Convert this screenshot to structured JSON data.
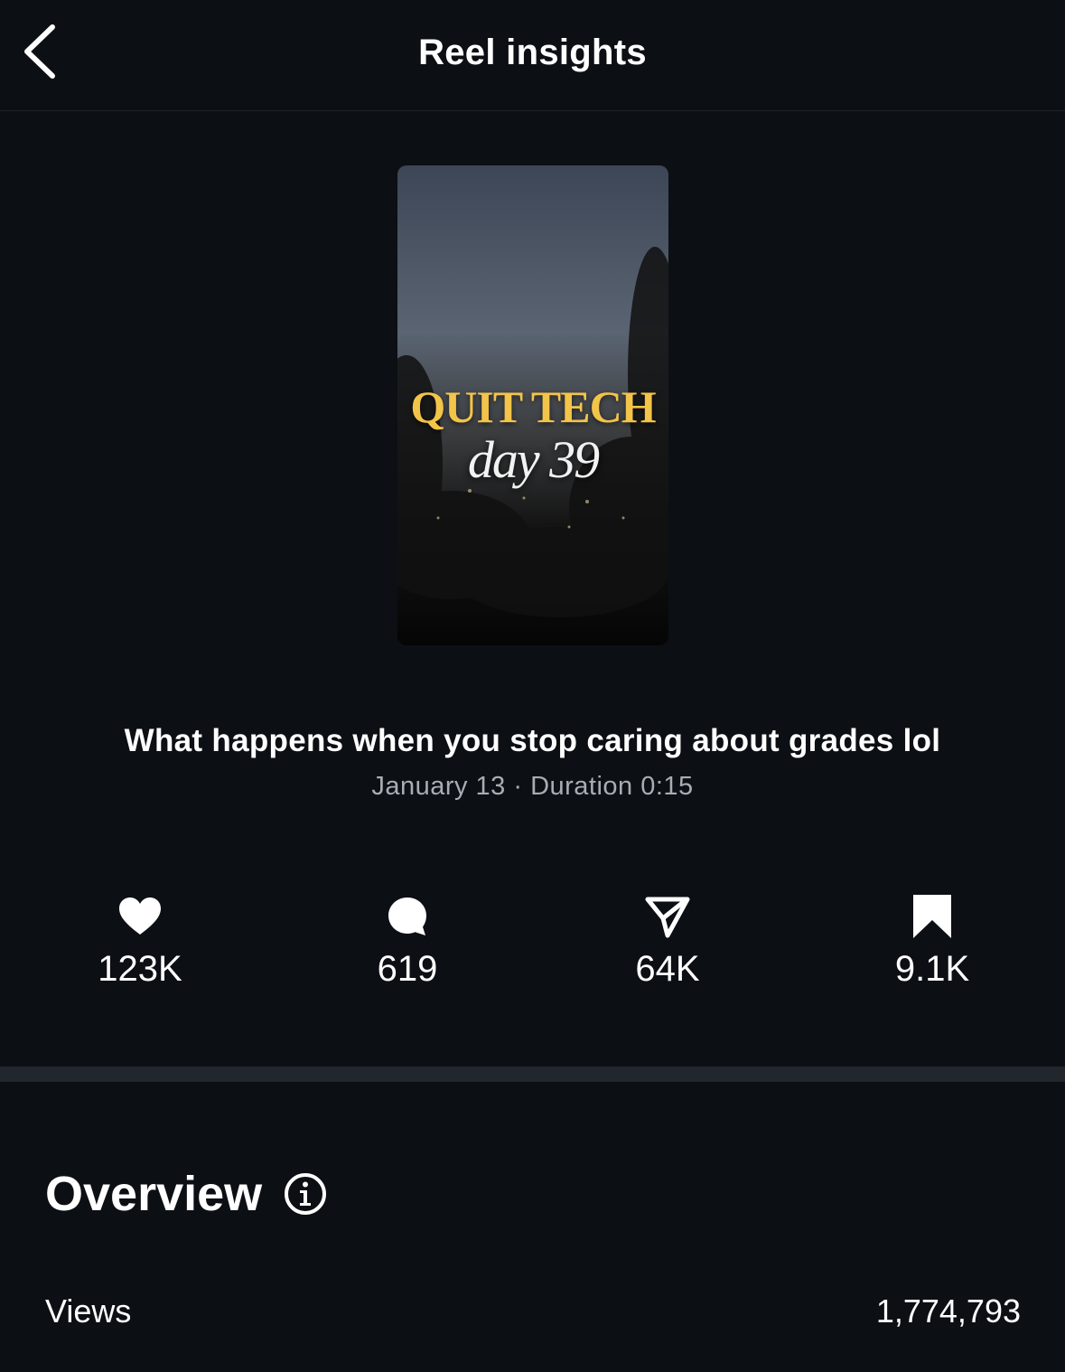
{
  "header": {
    "title": "Reel insights",
    "back_icon": "chevron-left-icon"
  },
  "reel": {
    "thumbnail": {
      "title_text": "QUIT TECH",
      "subtitle_text": "day 39",
      "title_color": "#f3c44a"
    },
    "caption": "What happens when you stop caring about grades lol",
    "meta": "January 13 · Duration 0:15"
  },
  "stats": [
    {
      "icon": "heart-icon",
      "value": "123K"
    },
    {
      "icon": "comment-icon",
      "value": "619"
    },
    {
      "icon": "send-icon",
      "value": "64K"
    },
    {
      "icon": "bookmark-icon",
      "value": "9.1K"
    }
  ],
  "overview": {
    "title": "Overview",
    "info_icon": "info-icon",
    "rows": [
      {
        "label": "Views",
        "value": "1,774,793"
      }
    ]
  },
  "colors": {
    "background": "#0c0f14",
    "divider": "#22262d",
    "secondary_text": "#a8adb5"
  }
}
